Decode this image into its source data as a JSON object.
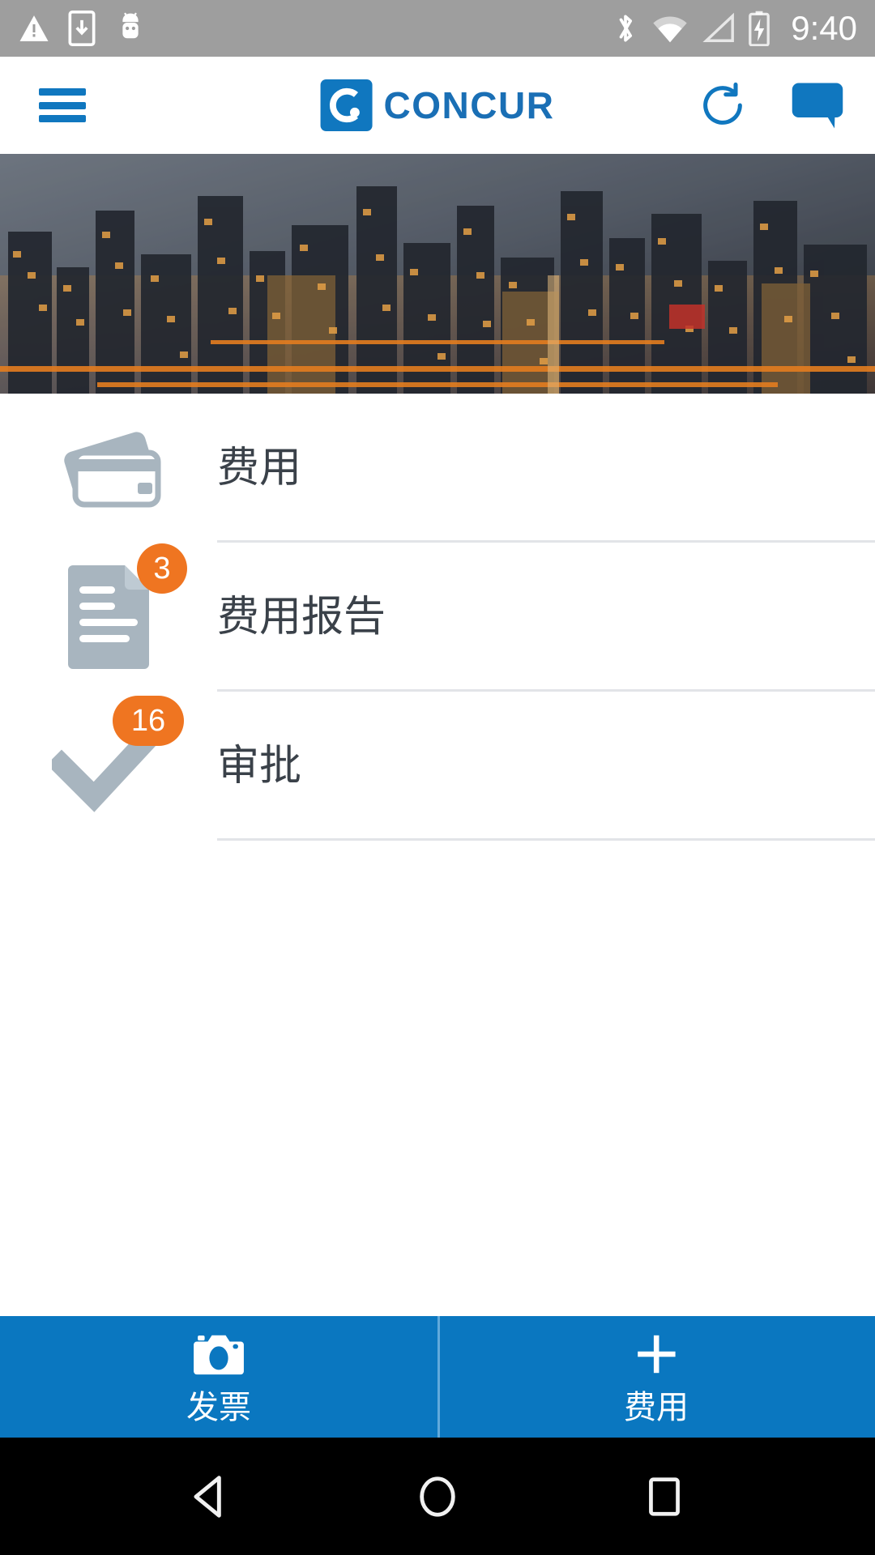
{
  "status_bar": {
    "time": "9:40",
    "left_icons": [
      "warning-triangle-icon",
      "download-to-device-icon",
      "android-robot-icon"
    ],
    "right_icons": [
      "bluetooth-icon",
      "wifi-icon",
      "cell-signal-icon",
      "battery-charging-icon"
    ],
    "background_color": "#9e9e9e"
  },
  "header": {
    "menu_icon": "hamburger-menu-icon",
    "brand_mark_letter": "C",
    "brand_name": "CONCUR",
    "refresh_icon": "refresh-icon",
    "chat_icon": "chat-bubble-icon",
    "accent_color": "#1077bf"
  },
  "hero": {
    "alt": "aerial night cityscape"
  },
  "list": {
    "items": [
      {
        "label": "费用",
        "icon": "credit-cards-icon",
        "badge": null
      },
      {
        "label": "费用报告",
        "icon": "document-report-icon",
        "badge": "3"
      },
      {
        "label": "审批",
        "icon": "checkmark-icon",
        "badge": "16"
      }
    ]
  },
  "action_bar": {
    "background_color": "#0a77c0",
    "buttons": [
      {
        "label": "发票",
        "icon": "camera-icon"
      },
      {
        "label": "费用",
        "icon": "plus-icon"
      }
    ]
  },
  "nav_bar": {
    "buttons": [
      {
        "name": "back",
        "icon": "back-triangle-icon"
      },
      {
        "name": "home",
        "icon": "home-circle-icon"
      },
      {
        "name": "recents",
        "icon": "recents-square-icon"
      }
    ]
  },
  "colors": {
    "badge_orange": "#ef7521",
    "icon_gray": "#a8b5bf",
    "text_dark": "#3a4149",
    "divider": "#e2e4e8"
  }
}
